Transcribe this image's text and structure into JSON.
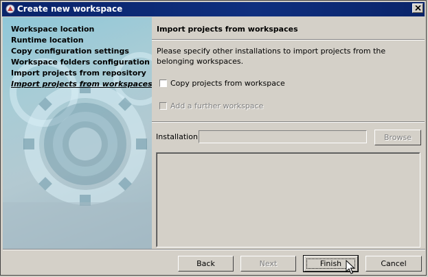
{
  "window": {
    "title": "Create new workspace",
    "icon": "eclipse-like-app-icon"
  },
  "sidebar": {
    "steps": [
      {
        "label": "Workspace location"
      },
      {
        "label": "Runtime location"
      },
      {
        "label": "Copy configuration settings"
      },
      {
        "label": "Workspace folders configuration"
      },
      {
        "label": "Import projects from repository"
      },
      {
        "label": "Import projects from workspaces",
        "current": true
      }
    ]
  },
  "page": {
    "title": "Import projects from workspaces",
    "description": "Please specify other installations to import projects from the belonging workspaces.",
    "copy_checkbox": {
      "label": "Copy projects from workspace",
      "checked": false
    },
    "further_checkbox": {
      "label": "Add a further workspace",
      "checked": false,
      "enabled": false
    },
    "installation": {
      "label": "Installation:",
      "value": ""
    },
    "browse_label": "Browse"
  },
  "footer": {
    "back_label": "Back",
    "next_label": "Next",
    "finish_label": "Finish",
    "cancel_label": "Cancel"
  }
}
